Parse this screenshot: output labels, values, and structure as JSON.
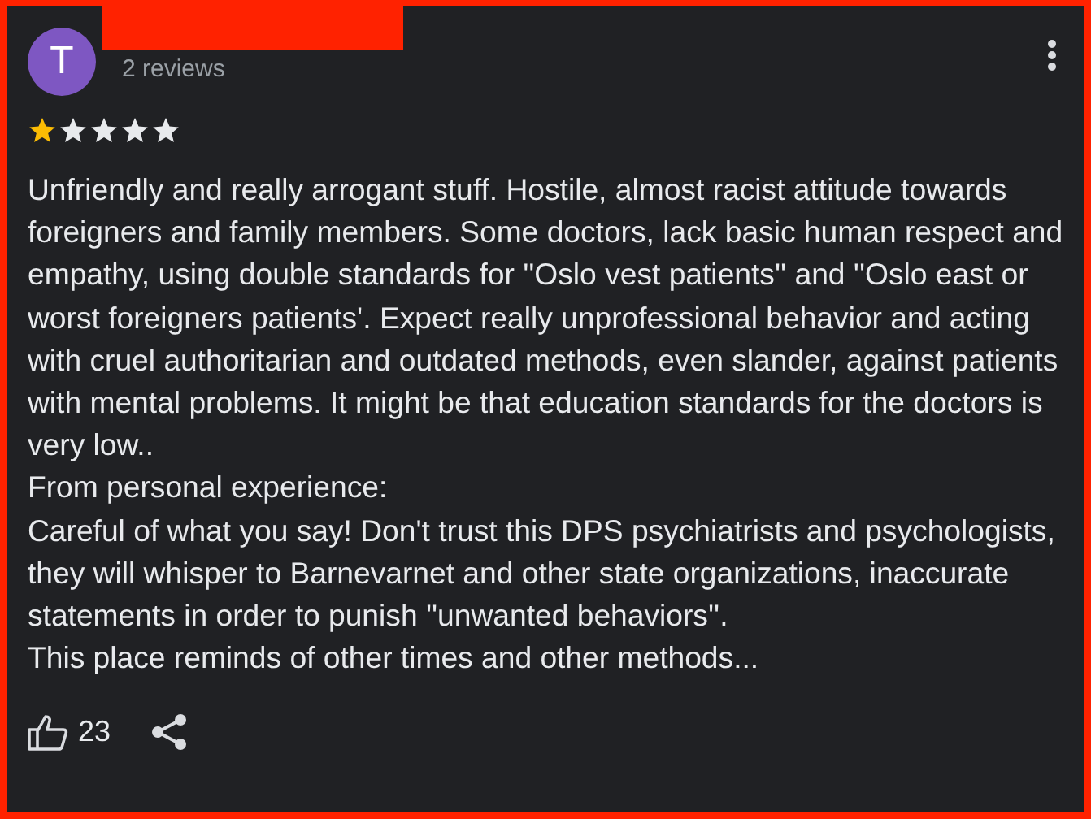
{
  "author": {
    "initial": "T",
    "name_redacted": true,
    "reviews": "2 reviews"
  },
  "rating": {
    "stars": 1
  },
  "review": {
    "text": "Unfriendly and really arrogant stuff. Hostile, almost racist attitude towards foreigners and family members. Some doctors, lack basic human respect and empathy, using double standards for ''Oslo vest patients'' and ''Oslo east or worst foreigners patients'. Expect really unprofessional behavior and acting with cruel authoritarian and outdated methods, even slander, against patients with mental problems. It might be that education standards for the doctors is very low..\nFrom personal experience:\nCareful of what you say! Don't trust this DPS psychiatrists and psychologists, they will whisper to Barnevarnet and other state organizations, inaccurate statements in order to punish ''unwanted behaviors''.\nThis place reminds of other times and other methods..."
  },
  "likes": "23"
}
